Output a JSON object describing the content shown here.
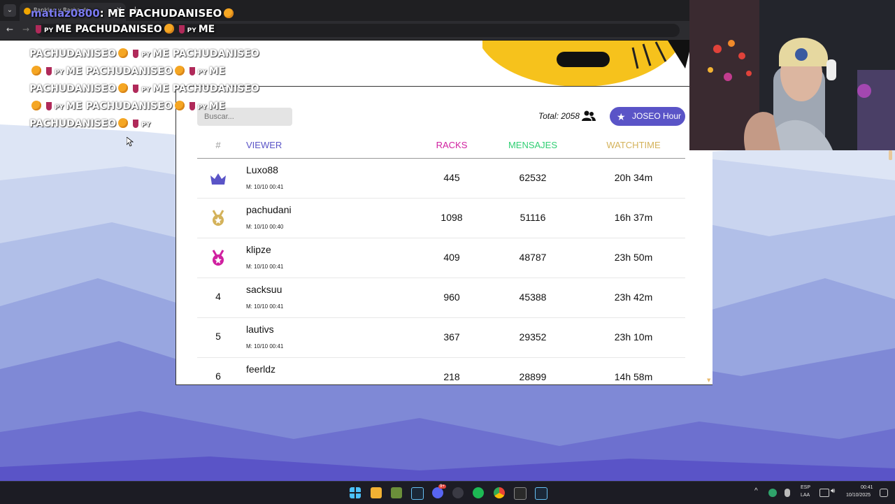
{
  "browser": {
    "tab_title": "Ranking y Racha de ...",
    "tab_close": "✕",
    "tab_new": "+",
    "menu_icon": "⌄",
    "back": "←",
    "forward": "→"
  },
  "chat": {
    "username": "matiaz0800",
    "header_msg": ": ME PACHUDANISEO",
    "line2": "ME PACHUDANISEO",
    "line2b": "ME",
    "lines": [
      [
        "PACHUDANISEO",
        "ME PACHUDANISEO"
      ],
      [
        "ME PACHUDANISEO",
        "ME"
      ],
      [
        "PACHUDANISEO",
        "ME PACHUDANISEO"
      ],
      [
        "ME PACHUDANISEO",
        "ME"
      ],
      [
        "PACHUDANISEO",
        ""
      ]
    ],
    "py": "PY"
  },
  "panel": {
    "search_placeholder": "Buscar...",
    "total_label": "Total: 2058",
    "joseo_label": "JOSEO Hour",
    "headers": {
      "rank": "#",
      "viewer": "VIEWER",
      "racks": "RACKS",
      "mensajes": "MENSAJES",
      "watchtime": "WATCHTIME"
    },
    "header_colors": {
      "rank": "#999999",
      "viewer": "#5a54c7",
      "racks": "#d020a0",
      "mensajes": "#2fcf73",
      "watchtime": "#d4b25a"
    },
    "rows": [
      {
        "rank": "",
        "icon": "crown-icon",
        "name": "Luxo88",
        "meta": "M: 10/10 00:41",
        "racks": "445",
        "mensajes": "62532",
        "watchtime": "20h 34m"
      },
      {
        "rank": "",
        "icon": "gold-medal-icon",
        "name": "pachudani",
        "meta": "M: 10/10 00:40",
        "racks": "1098",
        "mensajes": "51116",
        "watchtime": "16h 37m"
      },
      {
        "rank": "",
        "icon": "pink-medal-icon",
        "name": "klipze",
        "meta": "M: 10/10 00:41",
        "racks": "409",
        "mensajes": "48787",
        "watchtime": "23h 50m"
      },
      {
        "rank": "4",
        "icon": "",
        "name": "sacksuu",
        "meta": "M: 10/10 00:41",
        "racks": "960",
        "mensajes": "45388",
        "watchtime": "23h 42m"
      },
      {
        "rank": "5",
        "icon": "",
        "name": "lautivs",
        "meta": "M: 10/10 00:41",
        "racks": "367",
        "mensajes": "29352",
        "watchtime": "23h 10m"
      },
      {
        "rank": "6",
        "icon": "",
        "name": "feerldz",
        "meta": "",
        "racks": "218",
        "mensajes": "28899",
        "watchtime": "14h 58m"
      }
    ]
  },
  "taskbar": {
    "lang_top": "ESP",
    "lang_bottom": "LAA",
    "time": "00:41",
    "date": "10/10/2025",
    "discord_badge": "9+"
  },
  "colors": {
    "accent": "#5a54c7",
    "racks": "#d020a0",
    "mensajes": "#2fcf73",
    "watchtime": "#d4b25a",
    "gold_medal": "#d4b25a",
    "pink_medal": "#d020a0"
  }
}
